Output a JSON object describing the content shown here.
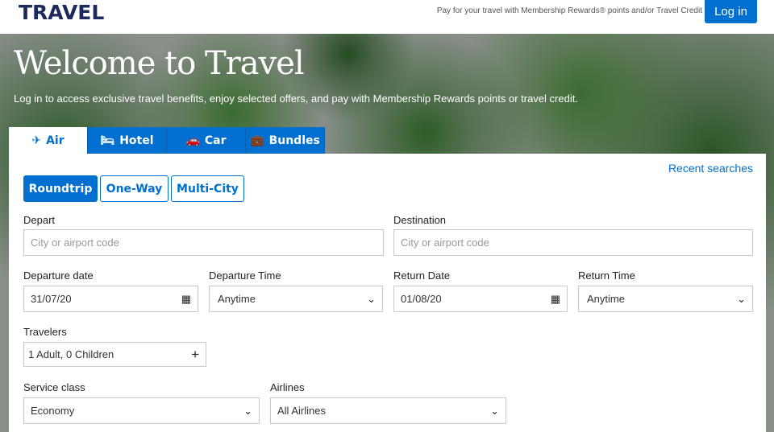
{
  "header": {
    "logo": "TRAVEL",
    "promo": "Pay for your travel with Membership Rewards® points and/or Travel Credit",
    "login": "Log in"
  },
  "hero": {
    "title": "Welcome to Travel",
    "subtitle": "Log in to access exclusive travel benefits, enjoy selected offers, and pay with Membership Rewards points or travel credit."
  },
  "tabs": [
    {
      "label": "Air",
      "icon": "✈"
    },
    {
      "label": "Hotel",
      "icon": "🛏"
    },
    {
      "label": "Car",
      "icon": "🚗"
    },
    {
      "label": "Bundles",
      "icon": "💼"
    }
  ],
  "form": {
    "recent": "Recent searches",
    "trip_types": [
      "Roundtrip",
      "One-Way",
      "Multi-City"
    ],
    "depart_label": "Depart",
    "depart_placeholder": "City or airport code",
    "destination_label": "Destination",
    "destination_placeholder": "City or airport code",
    "departure_date_label": "Departure date",
    "departure_date": "31/07/20",
    "departure_time_label": "Departure Time",
    "departure_time": "Anytime",
    "return_date_label": "Return Date",
    "return_date": "01/08/20",
    "return_time_label": "Return Time",
    "return_time": "Anytime",
    "travelers_label": "Travelers",
    "travelers": "1 Adult, 0 Children",
    "service_label": "Service class",
    "service": "Economy",
    "airlines_label": "Airlines",
    "airlines": "All Airlines"
  },
  "colors": {
    "accent": "#006fcf",
    "logo": "#1d2a5c"
  }
}
